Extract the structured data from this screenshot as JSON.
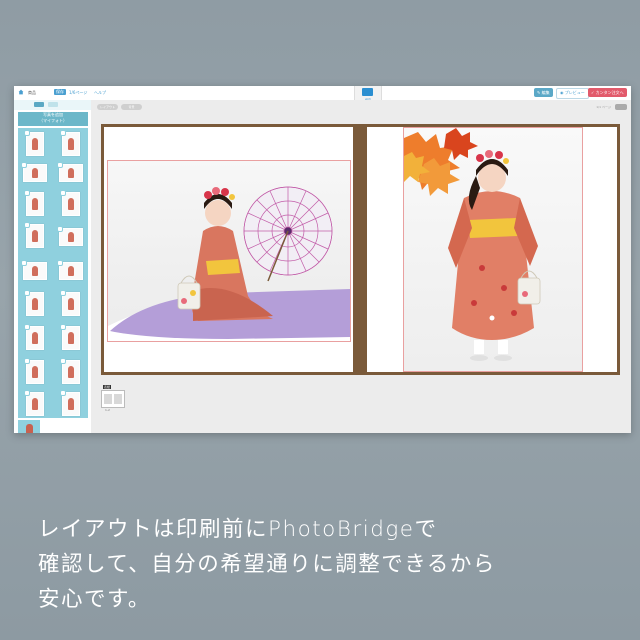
{
  "topbar": {
    "title": "商品",
    "status": "保存",
    "link1": "1/6ページ",
    "link2": "ヘルプ",
    "save_label": "保存",
    "edit_label": "編集",
    "preview_label": "プレビュー",
    "order_label": "カンタン注文へ"
  },
  "sidebar": {
    "header_line1": "写真を追加",
    "header_line2": "（マイフォト）"
  },
  "main": {
    "pill1": "レイアウト",
    "pill2": "背景",
    "note": "1/1 ページ"
  },
  "filmstrip": {
    "label": "表紙",
    "page": "1-2"
  },
  "caption": {
    "line1": "レイアウトは印刷前にPhotoBridgeで",
    "line2": "確認して、自分の希望通りに調整できるから",
    "line3": "安心です。"
  },
  "colors": {
    "accent": "#4a9fd0",
    "order": "#e25a6b",
    "panel": "#8fd0de",
    "book_cover": "#7a5a3a"
  },
  "icons": [
    "home-icon",
    "save-icon",
    "edit-icon",
    "eye-icon",
    "cart-icon"
  ]
}
